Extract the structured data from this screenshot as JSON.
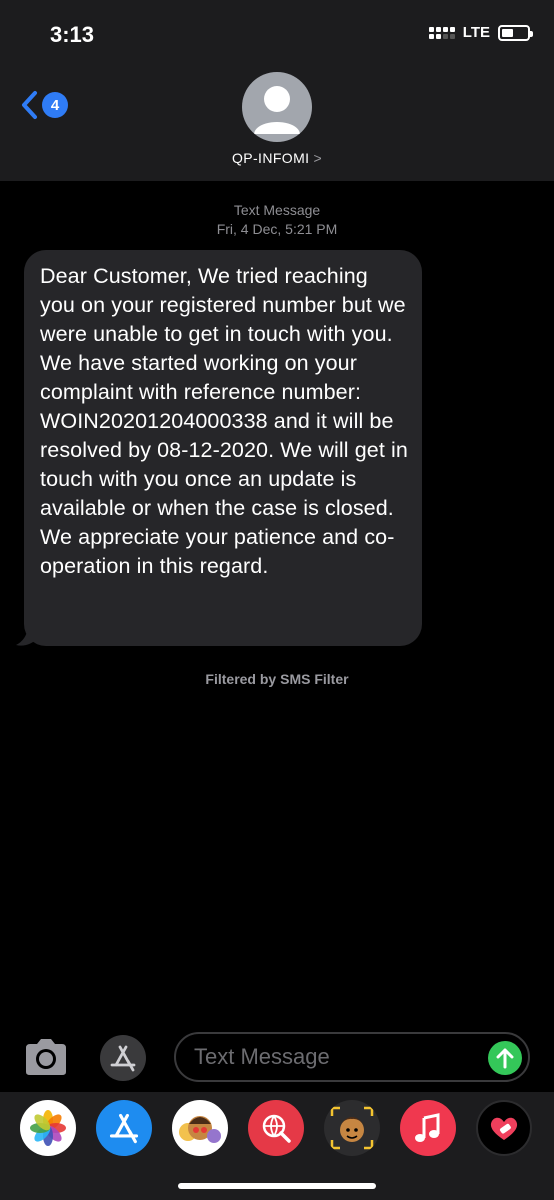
{
  "status": {
    "time": "3:13",
    "network": "LTE",
    "battery_level": 0.45
  },
  "header": {
    "back_count": "4",
    "contact_name": "QP-INFOMI",
    "contact_chevron": ">"
  },
  "conversation": {
    "meta_type": "Text Message",
    "meta_date": "Fri, 4 Dec, 5:21 PM",
    "message": "Dear Customer, We tried reaching you on your registered number but we were unable to get in touch with you. We have started working on your complaint with reference number: WOIN20201204000338 and it will be resolved by 08-12-2020. We will get in touch with you once an update is available or when the case is closed. We appreciate your patience and co-operation in this regard.",
    "filter_note": "Filtered by SMS Filter"
  },
  "compose": {
    "placeholder": "Text Message"
  },
  "drawer": {
    "apps": [
      {
        "name": "photos-app",
        "icon": "photos-icon",
        "color": "#ffffff"
      },
      {
        "name": "app-store-app",
        "icon": "app-store-icon",
        "color": "#1e8cf0"
      },
      {
        "name": "animoji-app",
        "icon": "memoji-stickers-icon",
        "color": "#ffffff"
      },
      {
        "name": "web-search-app",
        "icon": "globe-search-icon",
        "color": "#e53947"
      },
      {
        "name": "memoji-app",
        "icon": "memoji-icon",
        "color": "#2c2c2e"
      },
      {
        "name": "music-app",
        "icon": "music-note-icon",
        "color": "#f0384f"
      },
      {
        "name": "digital-touch-app",
        "icon": "heart-touch-icon",
        "color": "#000000"
      }
    ]
  },
  "colors": {
    "header_bg": "#1c1c1e",
    "bubble_bg": "#262629",
    "accent_blue": "#2f7cf6",
    "send_green": "#34c759"
  }
}
